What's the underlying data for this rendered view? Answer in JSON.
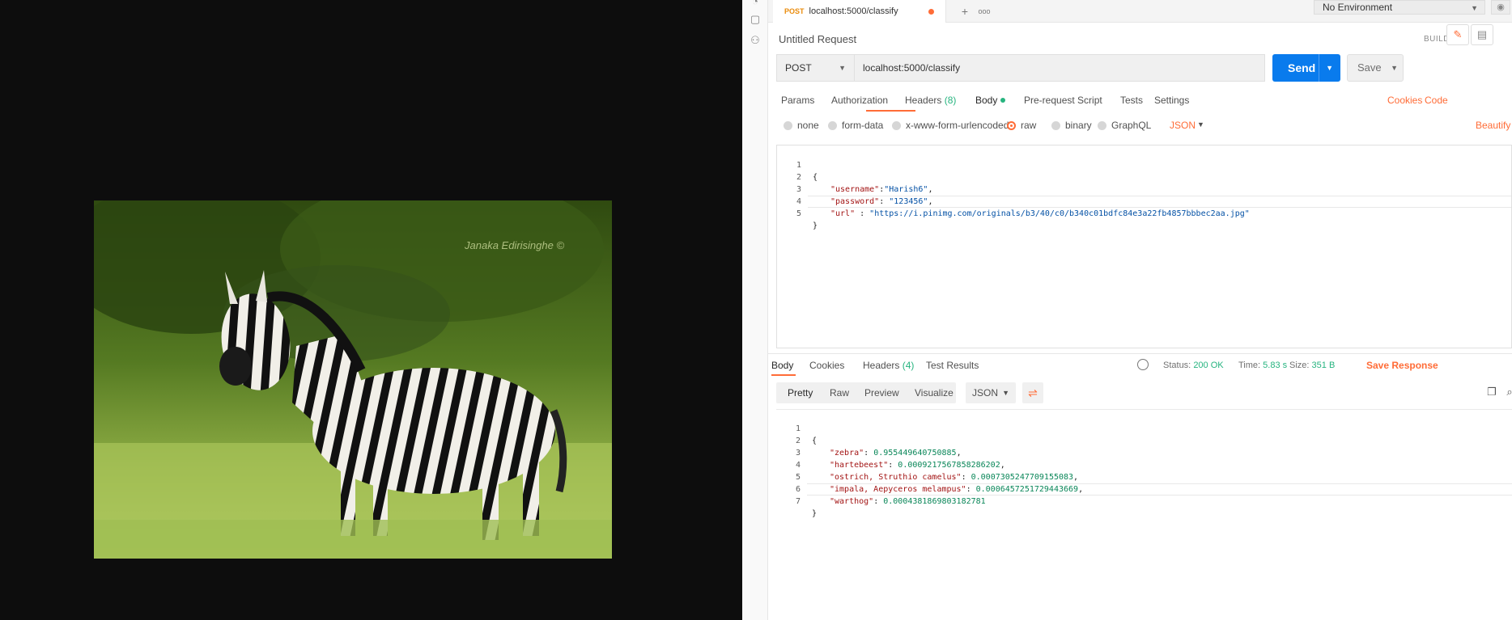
{
  "viewer": {
    "watermark": "Janaka Edirisinghe ©"
  },
  "tabbar": {
    "active_tab": {
      "method": "POST",
      "title": "localhost:5000/classify"
    },
    "add_tab_icon": "+",
    "more_icon": "ooo",
    "environment": "No Environment"
  },
  "request": {
    "title": "Untitled Request",
    "build_label": "BUILD",
    "method": "POST",
    "url": "localhost:5000/classify",
    "send_label": "Send",
    "save_label": "Save",
    "tabs": {
      "params": "Params",
      "authorization": "Authorization",
      "headers": "Headers",
      "headers_count": "(8)",
      "body": "Body",
      "prerequest": "Pre-request Script",
      "tests": "Tests",
      "settings": "Settings",
      "cookies": "Cookies",
      "code": "Code"
    },
    "body_types": {
      "none": "none",
      "form_data": "form-data",
      "urlencoded": "x-www-form-urlencoded",
      "raw": "raw",
      "binary": "binary",
      "graphql": "GraphQL",
      "format": "JSON",
      "beautify": "Beautify"
    },
    "body_lines": [
      {
        "n": "1",
        "text": "{"
      },
      {
        "n": "2",
        "key": "\"username\"",
        "sep": ":",
        "val": "\"Harish6\"",
        "end": ","
      },
      {
        "n": "3",
        "key": "\"password\"",
        "sep": ": ",
        "val": "\"123456\"",
        "end": ","
      },
      {
        "n": "4",
        "key": "\"url\"",
        "sep": " : ",
        "val": "\"https://i.pinimg.com/originals/b3/40/c0/b340c01bdfc84e3a22fb4857bbbec2aa.jpg\"",
        "end": ""
      },
      {
        "n": "5",
        "text": "}"
      }
    ]
  },
  "response": {
    "tabs": {
      "body": "Body",
      "cookies": "Cookies",
      "headers": "Headers",
      "headers_count": "(4)",
      "test_results": "Test Results"
    },
    "status_label": "Status:",
    "status": "200 OK",
    "time_label": "Time:",
    "time": "5.83 s",
    "size_label": "Size:",
    "size": "351 B",
    "save_response": "Save Response",
    "view_modes": {
      "pretty": "Pretty",
      "raw": "Raw",
      "preview": "Preview",
      "visualize": "Visualize"
    },
    "format": "JSON",
    "body_lines": [
      {
        "n": "1",
        "text": "{"
      },
      {
        "n": "2",
        "key": "\"zebra\"",
        "val": "0.955449640750885",
        "end": ","
      },
      {
        "n": "3",
        "key": "\"hartebeest\"",
        "val": "0.0009217567858286202",
        "end": ","
      },
      {
        "n": "4",
        "key": "\"ostrich, Struthio camelus\"",
        "val": "0.0007305247709155083",
        "end": ","
      },
      {
        "n": "5",
        "key": "\"impala, Aepyceros melampus\"",
        "val": "0.0006457251729443669",
        "end": ","
      },
      {
        "n": "6",
        "key": "\"warthog\"",
        "val": "0.0004381869803182781",
        "end": ""
      },
      {
        "n": "7",
        "text": "}"
      }
    ]
  },
  "colors": {
    "accent": "#ff6c37",
    "send": "#097bed",
    "success": "#26b47f",
    "method_post": "#ea8b0b"
  }
}
